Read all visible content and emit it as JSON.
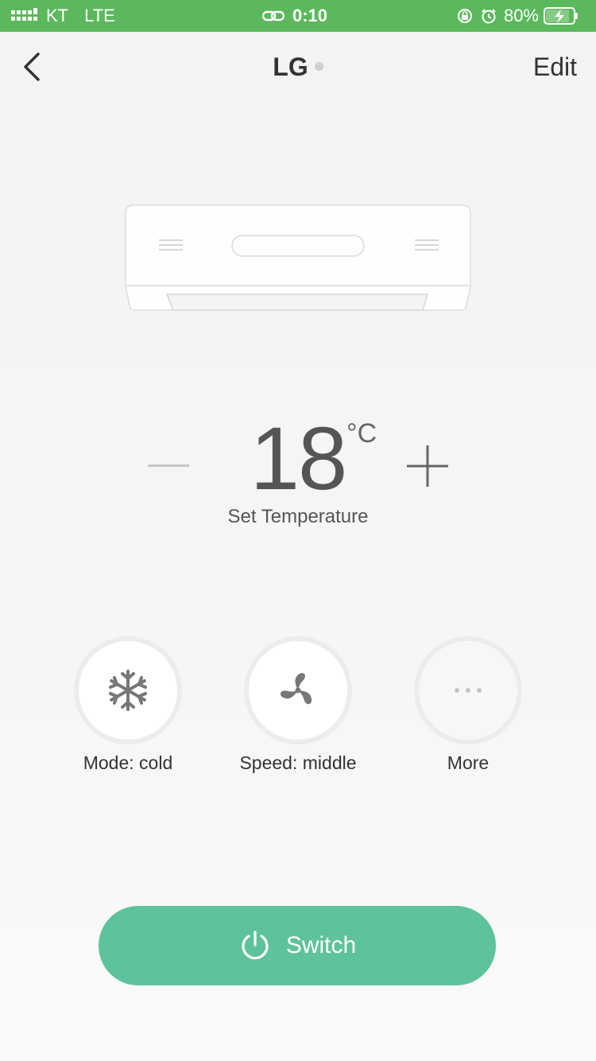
{
  "status_bar": {
    "carrier": "KT",
    "network": "LTE",
    "time": "0:10",
    "battery": "80%",
    "color": "#5cb85c"
  },
  "nav": {
    "title": "LG",
    "edit_label": "Edit",
    "back_icon": "chevron-left-icon"
  },
  "temperature": {
    "value": "18",
    "unit": "°C",
    "label": "Set Temperature"
  },
  "controls": [
    {
      "label": "Mode: cold",
      "icon": "snowflake-icon"
    },
    {
      "label": "Speed: middle",
      "icon": "fan-icon"
    },
    {
      "label": "More",
      "icon": "more-dots-icon"
    }
  ],
  "switch": {
    "label": "Switch",
    "icon": "power-icon",
    "color": "#5ec39a"
  }
}
